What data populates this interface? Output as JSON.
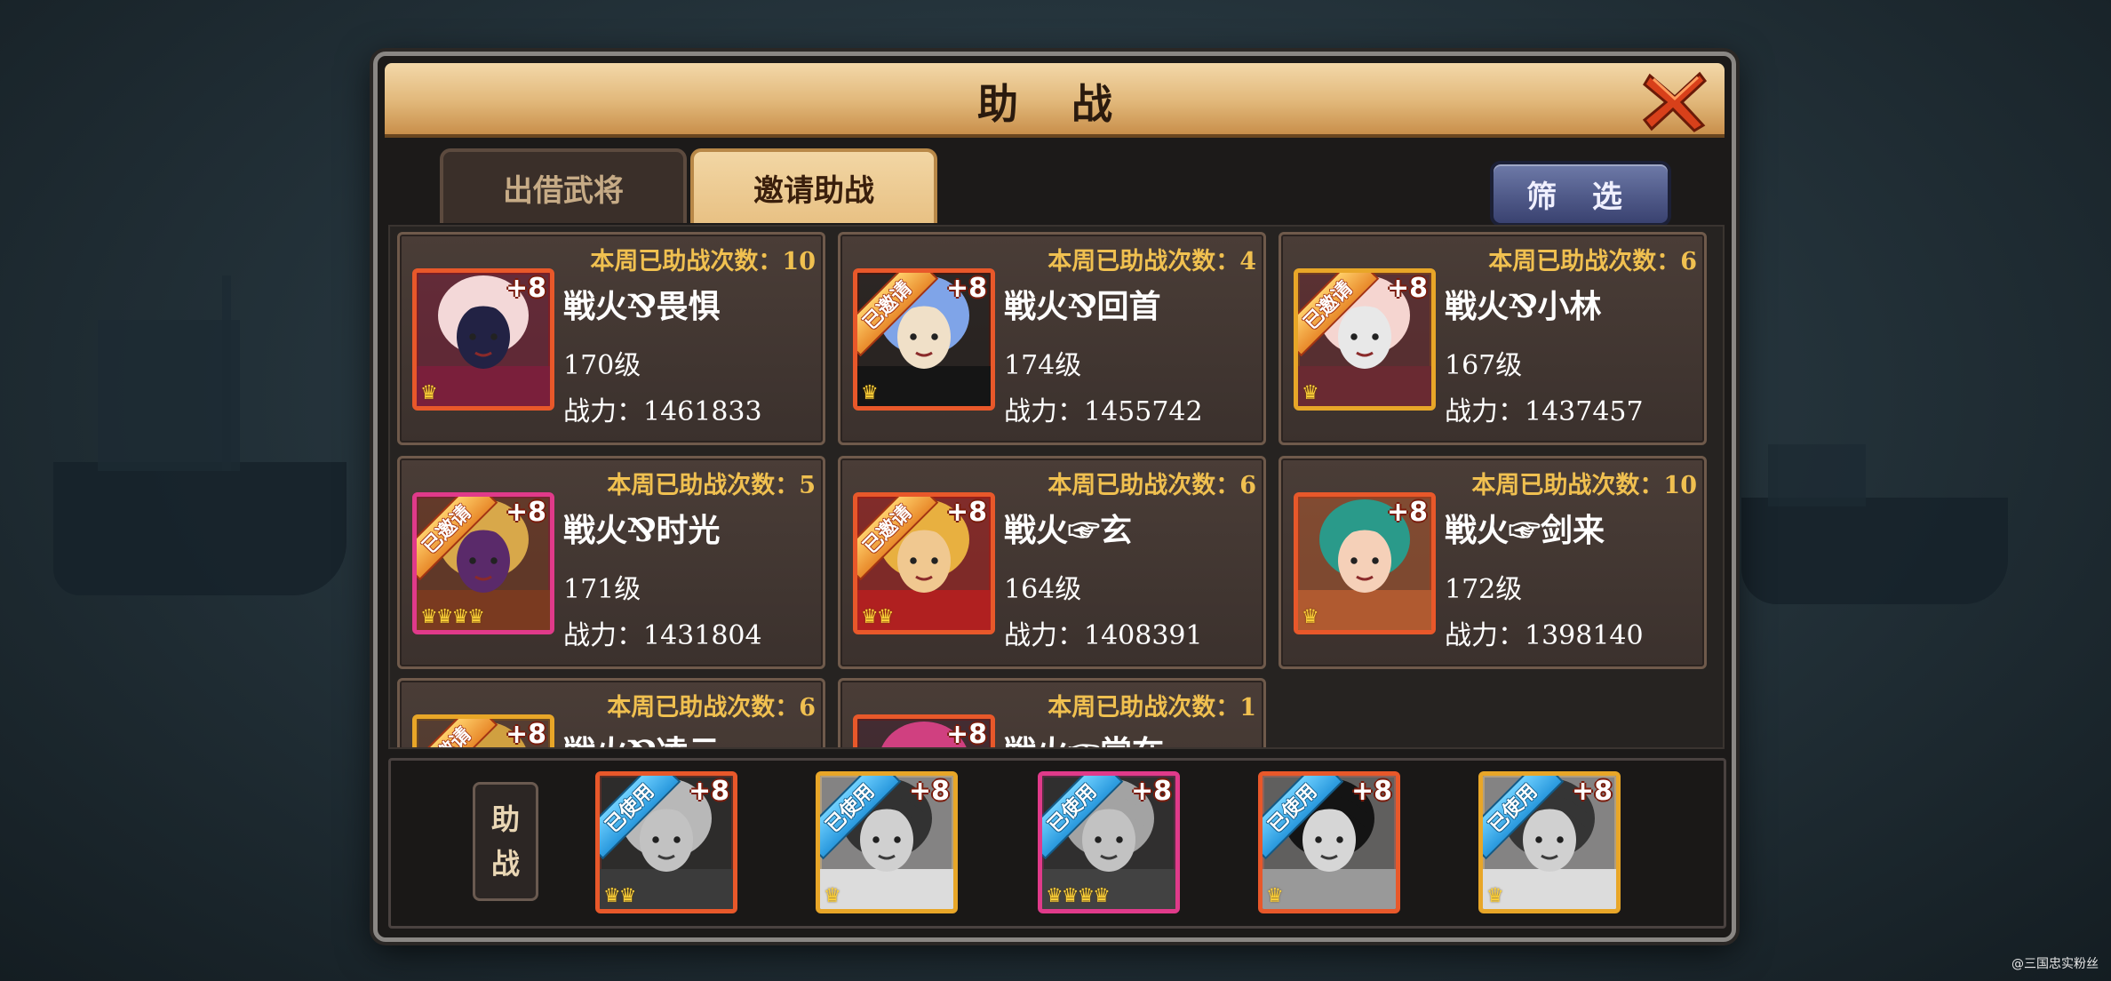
{
  "dialog": {
    "title": "助 战"
  },
  "tabs": [
    {
      "label": "出借武将",
      "active": false
    },
    {
      "label": "邀请助战",
      "active": true
    }
  ],
  "filter_label": "筛 选",
  "invited_badge": "已邀请",
  "used_badge": "已使用",
  "cards": [
    {
      "count": "本周已助战次数：10",
      "name": "戦火⅋畏惧",
      "level": "170级",
      "power": "战力：1461833",
      "plus": "+8",
      "stars": "♛",
      "invited": false,
      "frame": "orange",
      "palette": [
        "#f3d8d8",
        "#7a1f3b",
        "#222244"
      ]
    },
    {
      "count": "本周已助战次数：4",
      "name": "戦火⅋回首",
      "level": "174级",
      "power": "战力：1455742",
      "plus": "+8",
      "stars": "♛",
      "invited": true,
      "frame": "orange",
      "palette": [
        "#7fa4e8",
        "#151515",
        "#f0e0c8"
      ]
    },
    {
      "count": "本周已助战次数：6",
      "name": "戦火⅋小林",
      "level": "167级",
      "power": "战力：1437457",
      "plus": "+8",
      "stars": "♛",
      "invited": true,
      "frame": "gold",
      "palette": [
        "#f5d5d0",
        "#6a2a32",
        "#e8e8e8"
      ]
    },
    {
      "count": "本周已助战次数：5",
      "name": "戦火⅋时光",
      "level": "171级",
      "power": "战力：1431804",
      "plus": "+8",
      "stars": "♛♛♛♛",
      "invited": true,
      "frame": "pink",
      "palette": [
        "#d8a84a",
        "#7a3a20",
        "#5a2a6a"
      ]
    },
    {
      "count": "本周已助战次数：6",
      "name": "戦火☞玄",
      "level": "164级",
      "power": "战力：1408391",
      "plus": "+8",
      "stars": "♛♛",
      "invited": true,
      "frame": "orange",
      "palette": [
        "#e8b040",
        "#b02020",
        "#f0c890"
      ]
    },
    {
      "count": "本周已助战次数：10",
      "name": "戦火☞剑来",
      "level": "172级",
      "power": "战力：1398140",
      "plus": "+8",
      "stars": "♛",
      "invited": false,
      "frame": "orange",
      "palette": [
        "#2a9a8a",
        "#b05a30",
        "#f5d0b8"
      ]
    },
    {
      "count": "本周已助战次数：6",
      "name": "戦火⅋凌云",
      "level": "",
      "power": "",
      "plus": "+8",
      "stars": "",
      "invited": true,
      "frame": "gold",
      "palette": [
        "#d0a040",
        "#604030",
        "#f0d0b0"
      ]
    },
    {
      "count": "本周已助战次数：1",
      "name": "戦火☞常在",
      "level": "",
      "power": "",
      "plus": "+8",
      "stars": "",
      "invited": false,
      "frame": "orange",
      "palette": [
        "#d04080",
        "#402030",
        "#f0c0c0"
      ]
    }
  ],
  "assist": {
    "label_top": "助",
    "label_bottom": "战",
    "slots": [
      {
        "plus": "+8",
        "stars": "♛♛",
        "frame": "orange"
      },
      {
        "plus": "+8",
        "stars": "♛",
        "frame": "gold"
      },
      {
        "plus": "+8",
        "stars": "♛♛♛♛",
        "frame": "pink"
      },
      {
        "plus": "+8",
        "stars": "♛",
        "frame": "orange"
      },
      {
        "plus": "+8",
        "stars": "♛",
        "frame": "gold"
      }
    ]
  },
  "watermark": "@三国忠实粉丝"
}
